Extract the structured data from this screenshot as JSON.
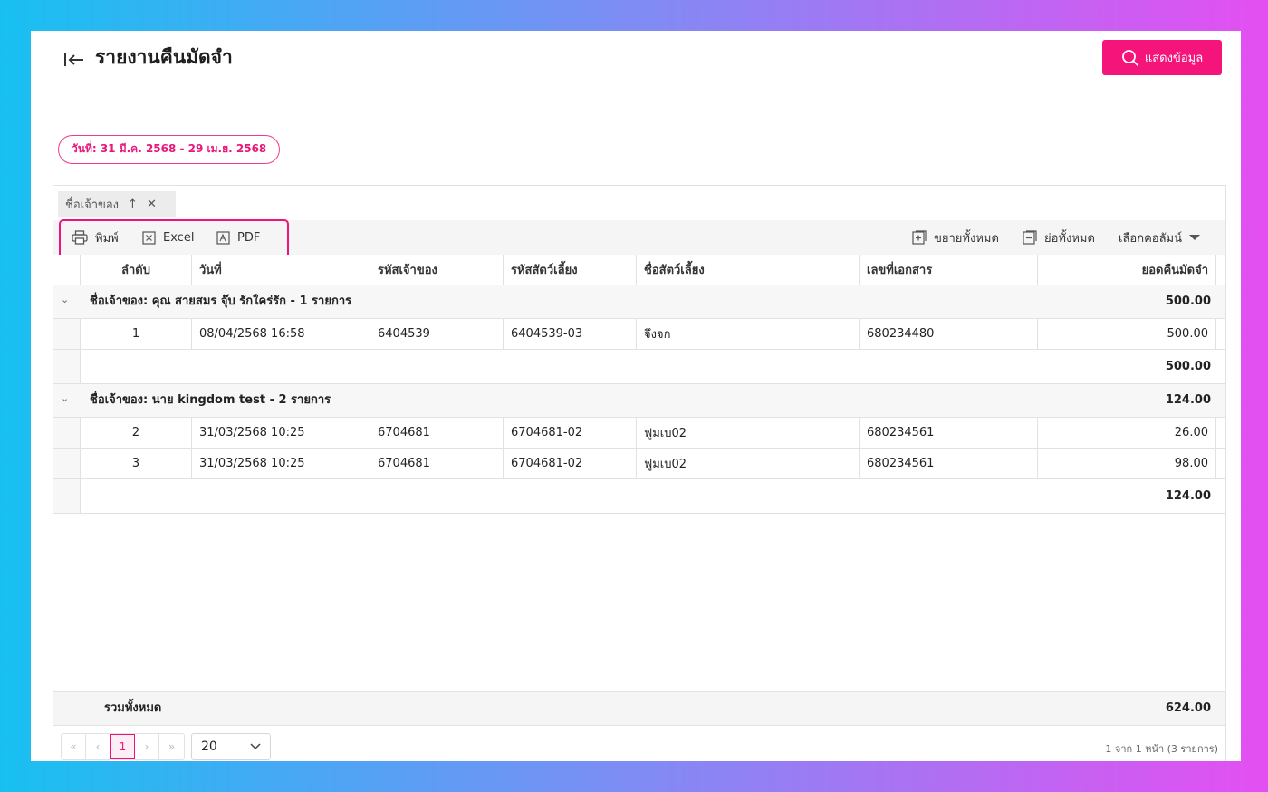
{
  "header": {
    "title": "รายงานคืนมัดจำ",
    "show_button": "แสดงข้อมูล"
  },
  "filter": {
    "date_chip": "วันที่: 31 มี.ค. 2568 - 29 เม.ย. 2568"
  },
  "group_panel": {
    "chip_label": "ชื่อเจ้าของ"
  },
  "toolbar": {
    "print": "พิมพ์",
    "excel": "Excel",
    "pdf": "PDF",
    "expand_all": "ขยายทั้งหมด",
    "collapse_all": "ย่อทั้งหมด",
    "choose_columns": "เลือกคอลัมน์"
  },
  "columns": [
    "ลำดับ",
    "วันที่",
    "รหัสเจ้าของ",
    "รหัสสัตว์เลี้ยง",
    "ชื่อสัตว์เลี้ยง",
    "เลขที่เอกสาร",
    "ยอดคืนมัดจำ"
  ],
  "groups": [
    {
      "title": "ชื่อเจ้าของ: คุณ สายสมร จุ๊บ รักใคร่รัก - 1 รายการ",
      "total": "500.00",
      "rows": [
        [
          "1",
          "08/04/2568 16:58",
          "6404539",
          "6404539-03",
          "จึงจก",
          "680234480",
          "500.00"
        ]
      ],
      "subtotal": "500.00"
    },
    {
      "title": "ชื่อเจ้าของ: นาย kingdom test - 2 รายการ",
      "total": "124.00",
      "rows": [
        [
          "2",
          "31/03/2568 10:25",
          "6704681",
          "6704681-02",
          "ฟูมเบ02",
          "680234561",
          "26.00"
        ],
        [
          "3",
          "31/03/2568 10:25",
          "6704681",
          "6704681-02",
          "ฟูมเบ02",
          "680234561",
          "98.00"
        ]
      ],
      "subtotal": "124.00"
    }
  ],
  "grand_total": {
    "label": "รวมทั้งหมด",
    "value": "624.00"
  },
  "pager": {
    "first": "«",
    "prev": "‹",
    "page": "1",
    "next": "›",
    "last": "»",
    "page_size": "20",
    "info": "1 จาก 1 หน้า (3 รายการ)"
  },
  "colors": {
    "accent": "#f5147a"
  }
}
